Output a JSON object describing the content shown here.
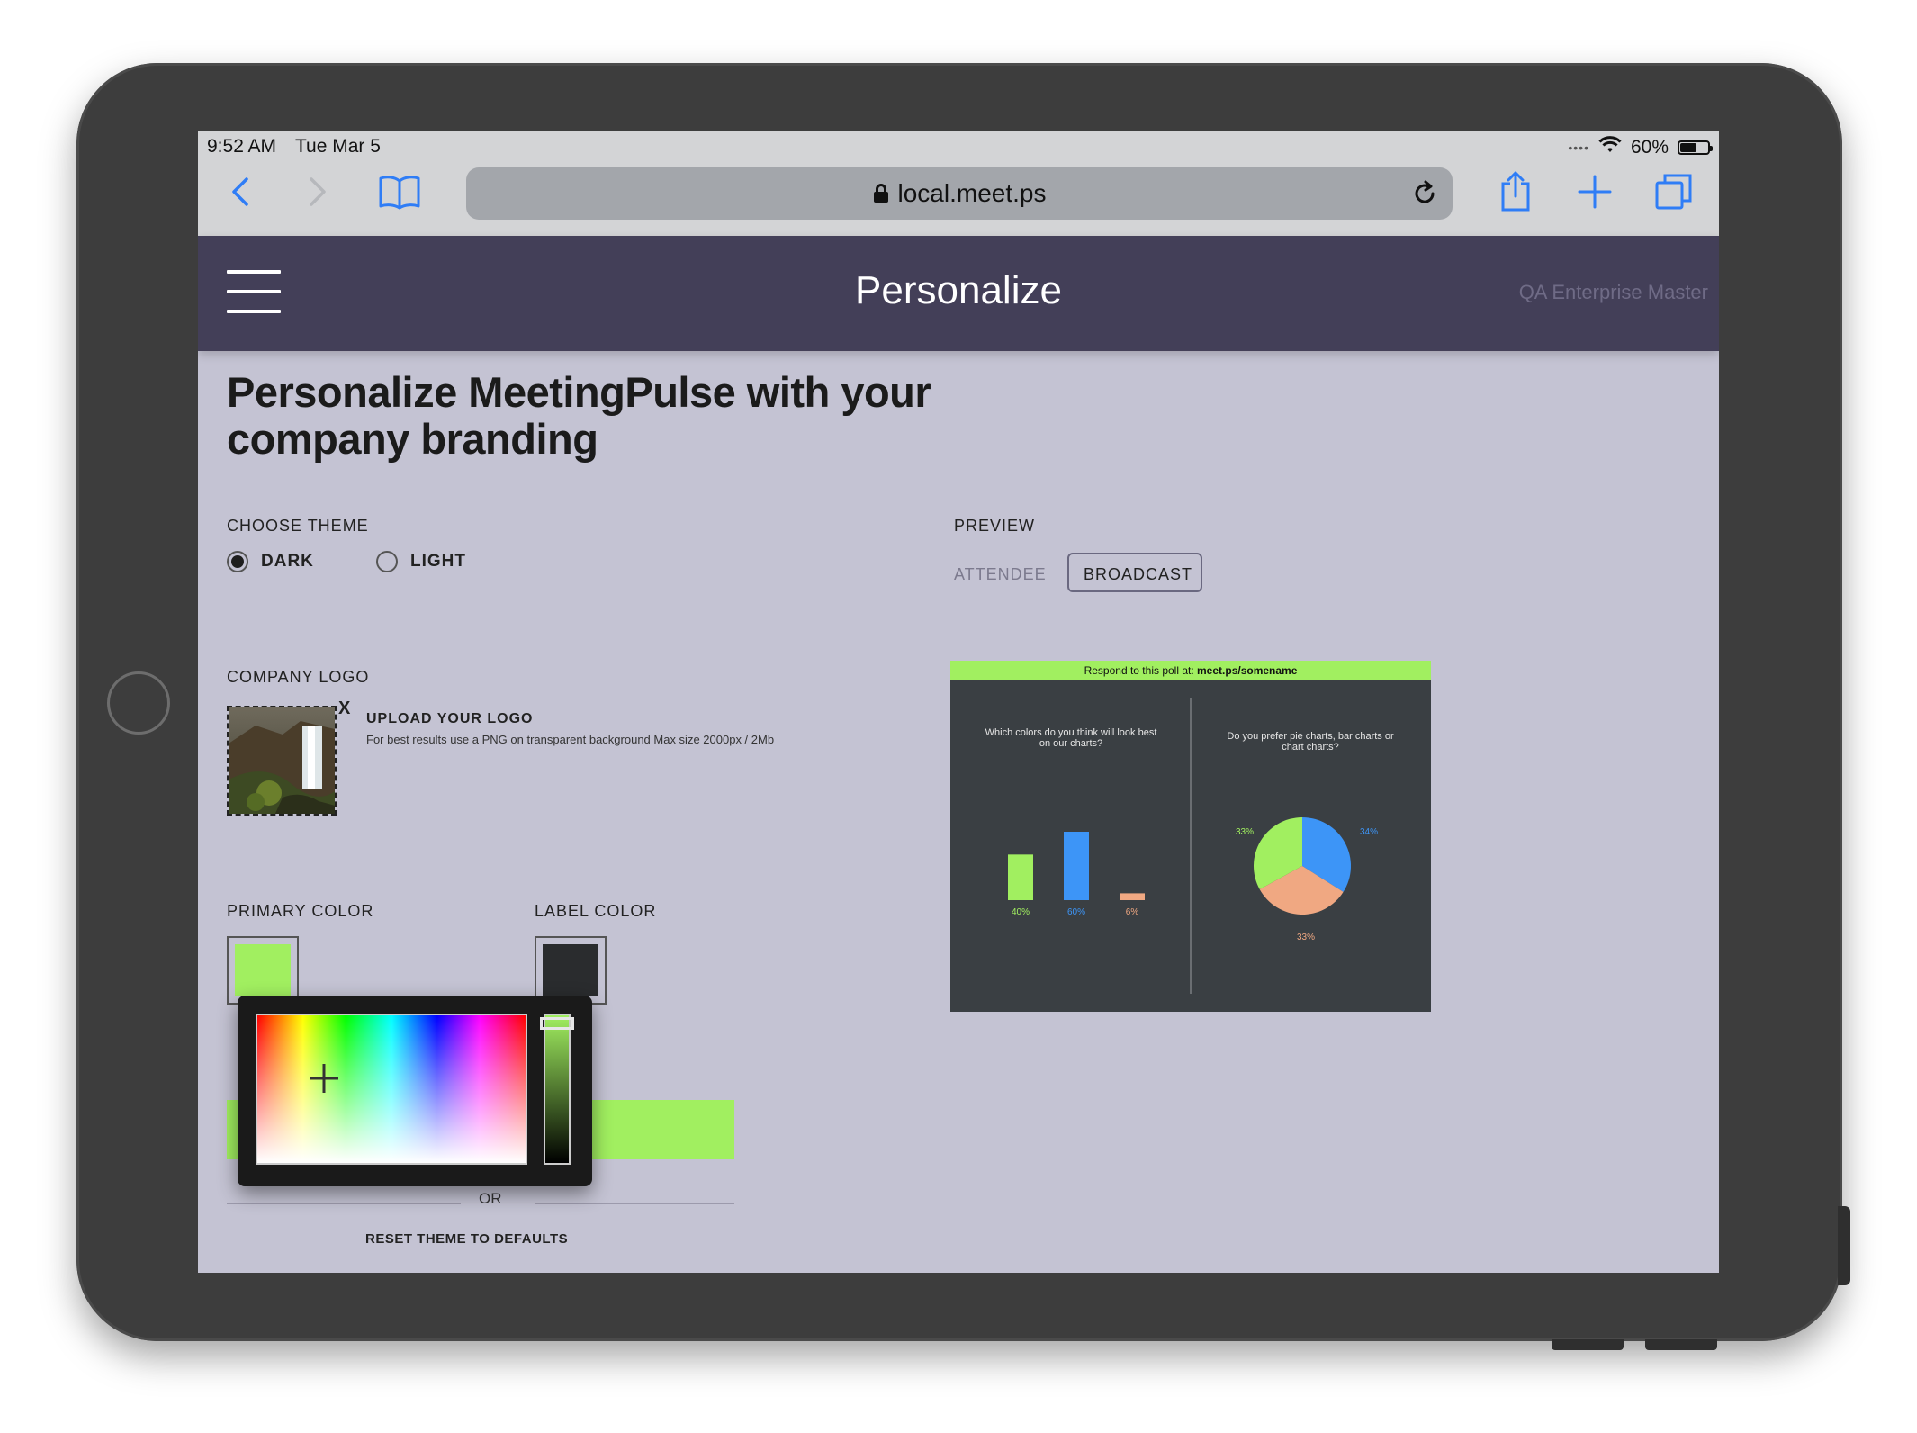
{
  "status_bar": {
    "time": "9:52 AM",
    "date": "Tue Mar 5",
    "battery_text": "60%",
    "battery_level": 0.6
  },
  "browser": {
    "url": "local.meet.ps"
  },
  "app": {
    "title": "Personalize",
    "account": "QA Enterprise Master"
  },
  "page": {
    "heading": "Personalize MeetingPulse with your company branding",
    "choose_theme_label": "CHOOSE THEME",
    "theme_options": [
      {
        "label": "DARK",
        "checked": true
      },
      {
        "label": "LIGHT",
        "checked": false
      }
    ],
    "company_logo_label": "COMPANY LOGO",
    "logo_remove": "X",
    "upload_title": "UPLOAD YOUR LOGO",
    "upload_hint": "For best results use a PNG on transparent background Max size 2000px / 2Mb",
    "primary_color_label": "PRIMARY COLOR",
    "label_color_label": "LABEL COLOR",
    "or_text": "OR",
    "reset_label": "RESET THEME TO DEFAULTS"
  },
  "colors": {
    "primary": "#a1ef60",
    "label": "#2a2c2e",
    "header_bg": "#433f58",
    "page_bg": "#c4c3d3"
  },
  "preview": {
    "label": "PREVIEW",
    "tabs": [
      {
        "label": "ATTENDEE",
        "active": false
      },
      {
        "label": "BROADCAST",
        "active": true
      }
    ],
    "banner_text": "Respond to this poll at: ",
    "banner_link": "meet.ps/somename",
    "question_left": "Which colors do you think will look best on our charts?",
    "question_right": "Do you prefer pie charts, bar charts or chart charts?"
  },
  "chart_data": [
    {
      "type": "bar",
      "categories": [
        "",
        "",
        ""
      ],
      "values": [
        40,
        60,
        6
      ],
      "data_labels": [
        "40%",
        "60%",
        "6%"
      ],
      "colors": [
        "#a1ef60",
        "#3d95f7",
        "#f0a882"
      ]
    },
    {
      "type": "pie",
      "values": [
        34,
        33,
        33
      ],
      "data_labels": [
        "34%",
        "33%",
        "33%"
      ],
      "colors": [
        "#3d95f7",
        "#f0a882",
        "#a1ef60"
      ]
    }
  ]
}
